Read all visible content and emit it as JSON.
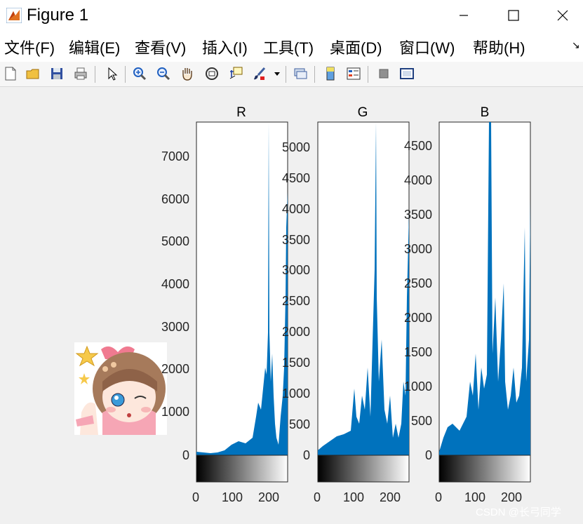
{
  "window": {
    "title": "Figure 1"
  },
  "menu": [
    "文件(F)",
    "编辑(E)",
    "查看(V)",
    "插入(I)",
    "工具(T)",
    "桌面(D)",
    "窗口(W)",
    "帮助(H)"
  ],
  "menu_overflow": "↘",
  "toolbar_icons": [
    "new-figure-icon",
    "open-file-icon",
    "save-icon",
    "print-icon",
    "pointer-icon",
    "zoom-in-icon",
    "zoom-out-icon",
    "pan-hand-icon",
    "rotate-3d-icon",
    "data-cursor-icon",
    "brush-icon",
    "link-plot-icon",
    "insert-colorbar-icon",
    "insert-legend-icon",
    "hide-plot-tools-icon",
    "show-plot-tools-icon"
  ],
  "panels": [
    {
      "title": "R",
      "yticks": [
        "0",
        "1000",
        "2000",
        "3000",
        "4000",
        "5000",
        "6000",
        "7000"
      ],
      "xticks": [
        "0",
        "100",
        "200"
      ]
    },
    {
      "title": "G",
      "yticks": [
        "0",
        "500",
        "1000",
        "1500",
        "2000",
        "2500",
        "3000",
        "3500",
        "4000",
        "4500",
        "5000"
      ],
      "xticks": [
        "0",
        "100",
        "200"
      ]
    },
    {
      "title": "B",
      "yticks": [
        "0",
        "500",
        "1000",
        "1500",
        "2000",
        "2500",
        "3000",
        "3500",
        "4000",
        "4500"
      ],
      "xticks": [
        "0",
        "100",
        "200"
      ]
    }
  ],
  "histogram_color": "#0072bd",
  "watermark": "CSDN @长弓同学"
}
